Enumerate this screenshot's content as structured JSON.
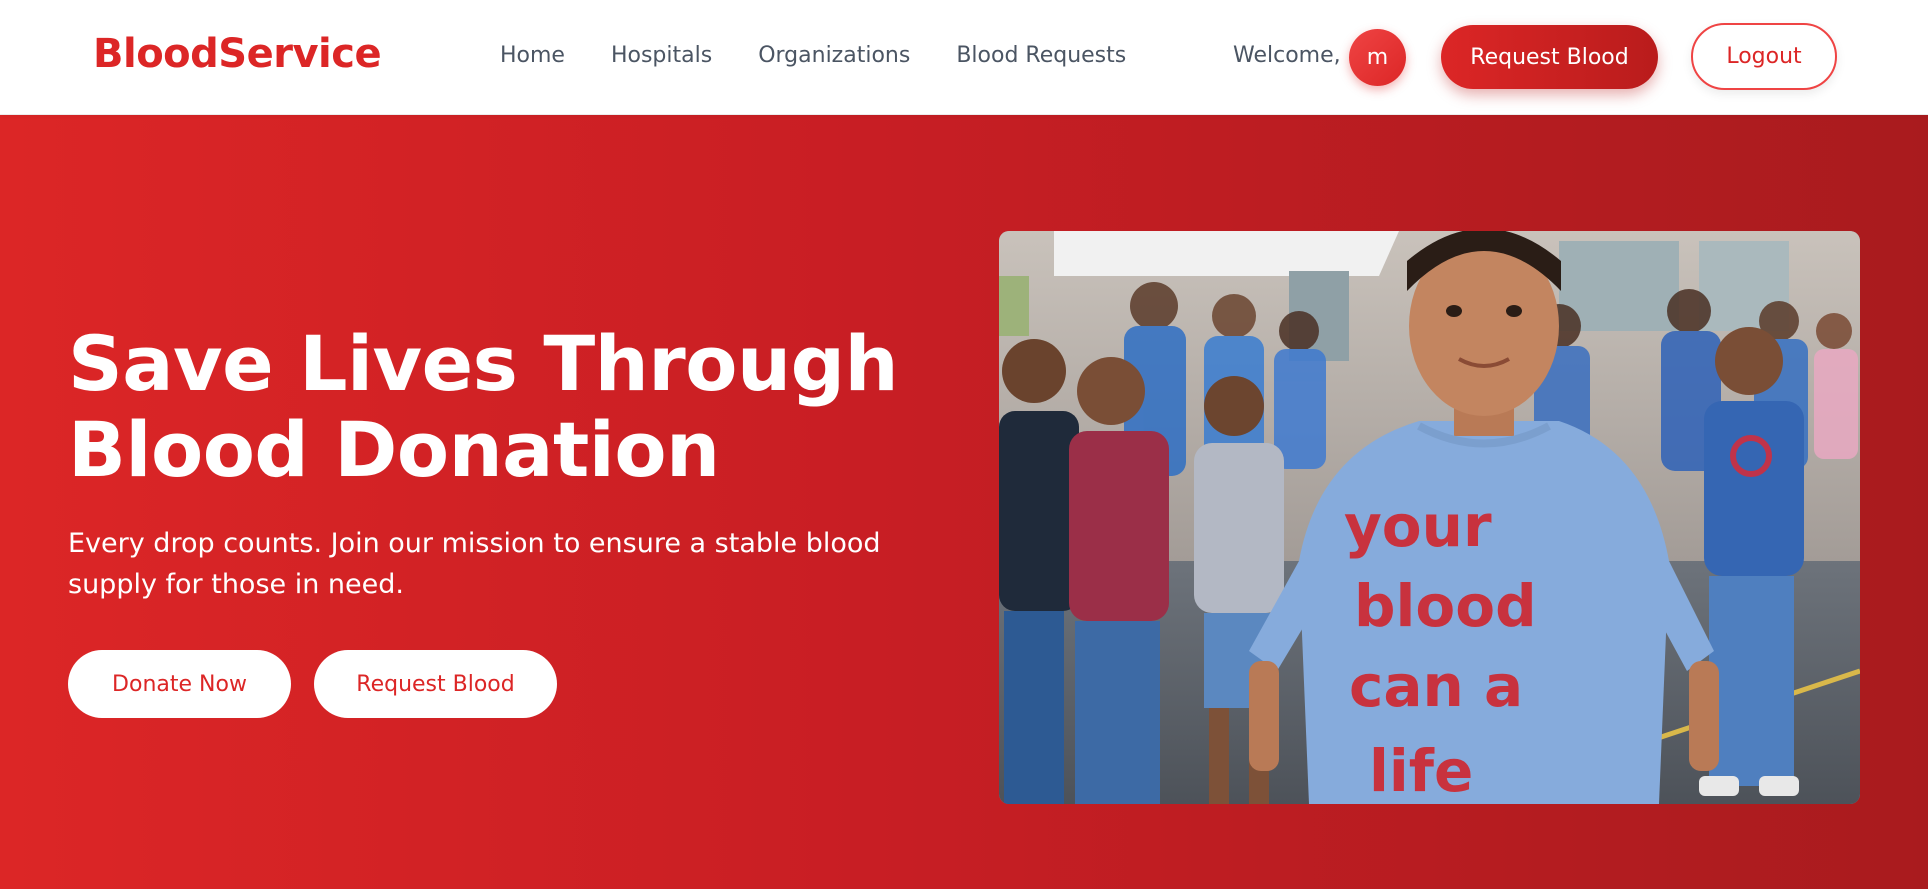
{
  "nav": {
    "brand": "BloodService",
    "links": [
      "Home",
      "Hospitals",
      "Organizations",
      "Blood Requests"
    ],
    "welcome": "Welcome,",
    "avatar_initial": "m",
    "request_label": "Request Blood",
    "logout_label": "Logout"
  },
  "hero": {
    "title": "Save Lives Through Blood Donation",
    "subtitle": "Every drop counts. Join our mission to ensure a stable blood supply for those in need.",
    "donate_label": "Donate Now",
    "request_label": "Request Blood",
    "image": {
      "shirt_text": [
        "your",
        "blood",
        "can a",
        "life"
      ]
    }
  },
  "colors": {
    "accent": "#dc2626",
    "accent_dark": "#a91b1e",
    "text_muted": "#4b5563"
  }
}
